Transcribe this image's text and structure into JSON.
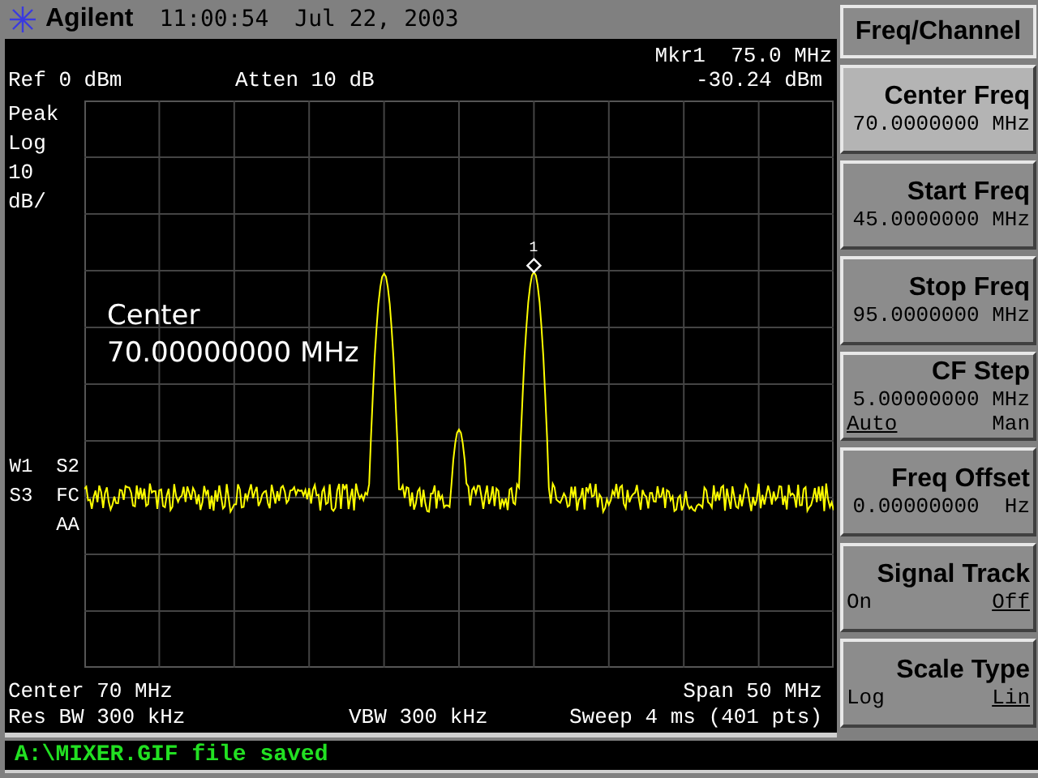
{
  "header": {
    "brand": "Agilent",
    "time": "11:00:54",
    "date": "Jul 22, 2003"
  },
  "display": {
    "marker_readout": "Mkr1  75.0 MHz",
    "marker_amplitude": "-30.24 dBm",
    "ref_level": "Ref 0 dBm",
    "attenuation": "Atten 10 dB",
    "scale_annotations": [
      "Peak",
      "Log",
      "10",
      "dB/"
    ],
    "trace_annotations": [
      "W1  S2",
      "S3  FC",
      "AA"
    ],
    "active_function": {
      "label": "Center",
      "value": "70.00000000 MHz"
    },
    "marker": {
      "label": "1"
    },
    "center": "Center 70 MHz",
    "span": "Span 50 MHz",
    "res_bw": "Res BW 300 kHz",
    "vbw": "VBW 300 kHz",
    "sweep": "Sweep 4 ms (401 pts)"
  },
  "menu": {
    "title": "Freq/Channel",
    "keys": [
      {
        "kind": "value",
        "label": "Center Freq",
        "value": "70.0000000 MHz",
        "selected": true
      },
      {
        "kind": "value",
        "label": "Start Freq",
        "value": "45.0000000 MHz",
        "selected": false
      },
      {
        "kind": "value",
        "label": "Stop Freq",
        "value": "95.0000000 MHz",
        "selected": false
      },
      {
        "kind": "value_toggle",
        "label": "CF Step",
        "value": "5.00000000 MHz",
        "selected": false,
        "options": [
          {
            "label": "Auto",
            "selected": true
          },
          {
            "label": "Man",
            "selected": false
          }
        ]
      },
      {
        "kind": "value",
        "label": "Freq Offset",
        "value": "0.00000000  Hz",
        "selected": false
      },
      {
        "kind": "toggle",
        "label": "Signal Track",
        "selected": false,
        "options": [
          {
            "label": "On",
            "selected": false
          },
          {
            "label": "Off",
            "selected": true
          }
        ]
      },
      {
        "kind": "toggle",
        "label": "Scale Type",
        "selected": false,
        "options": [
          {
            "label": "Log",
            "selected": false
          },
          {
            "label": "Lin",
            "selected": true
          }
        ]
      }
    ]
  },
  "status_bar": {
    "message": "A:\\MIXER.GIF file saved"
  }
}
